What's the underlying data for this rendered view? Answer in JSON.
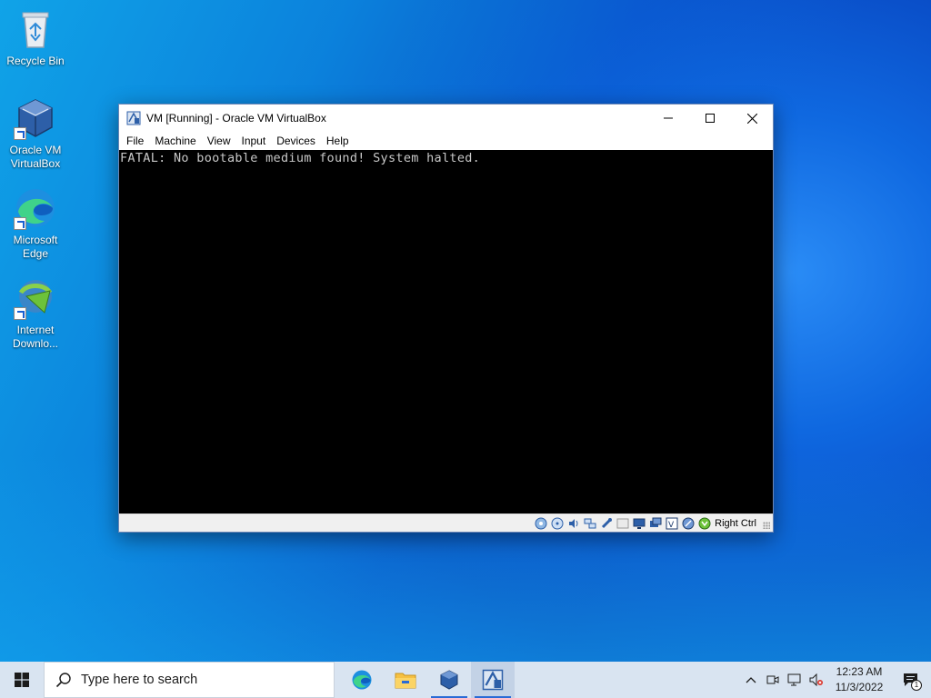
{
  "desktop": {
    "icons": [
      {
        "label": "Recycle Bin"
      },
      {
        "label": "Oracle VM VirtualBox"
      },
      {
        "label": "Microsoft Edge"
      },
      {
        "label": "Internet Downlo..."
      }
    ]
  },
  "window": {
    "title": "VM [Running] - Oracle VM VirtualBox",
    "menu": [
      "File",
      "Machine",
      "View",
      "Input",
      "Devices",
      "Help"
    ],
    "console_text": "FATAL: No bootable medium found! System halted.",
    "status_host_key": "Right Ctrl"
  },
  "taskbar": {
    "search_placeholder": "Type here to search",
    "time": "12:23 AM",
    "date": "11/3/2022",
    "notification_count": "1"
  },
  "colors": {
    "taskbar_bg": "#d9e4f1",
    "console_bg": "#000000",
    "console_text": "#c8c8c8",
    "accent": "#2a6bd6"
  }
}
